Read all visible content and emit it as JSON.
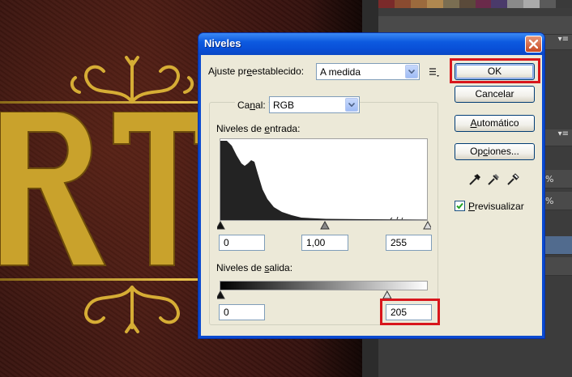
{
  "dialog": {
    "title": "Niveles",
    "preset_label_parts": [
      "Ajuste pr",
      "e",
      "establecido:"
    ],
    "preset_value": "A medida",
    "channel_label_parts": [
      "Ca",
      "n",
      "al:"
    ],
    "channel_value": "RGB",
    "input_levels_label_parts": [
      "Niveles de ",
      "e",
      "ntrada:"
    ],
    "input_black": "0",
    "input_gamma": "1,00",
    "input_white": "255",
    "output_levels_label_parts": [
      "Niveles de ",
      "s",
      "alida:"
    ],
    "output_black": "0",
    "output_white": "205",
    "output_white_fraction": 0.804,
    "ok_label": "OK",
    "cancel_label": "Cancelar",
    "auto_label_parts": [
      "",
      "A",
      "utomático"
    ],
    "options_label_parts": [
      "Op",
      "c",
      "iones..."
    ],
    "preview_label_parts": [
      "",
      "P",
      "revisualizar"
    ],
    "preview_checked": true
  },
  "panels": {
    "percent_a": "%",
    "percent_b": "%"
  },
  "colors": {
    "highlight_red": "#d8161c",
    "xp_title_blue": "#0a48c4",
    "dialog_face": "#ece9d8",
    "gold": "#c9a22c"
  }
}
